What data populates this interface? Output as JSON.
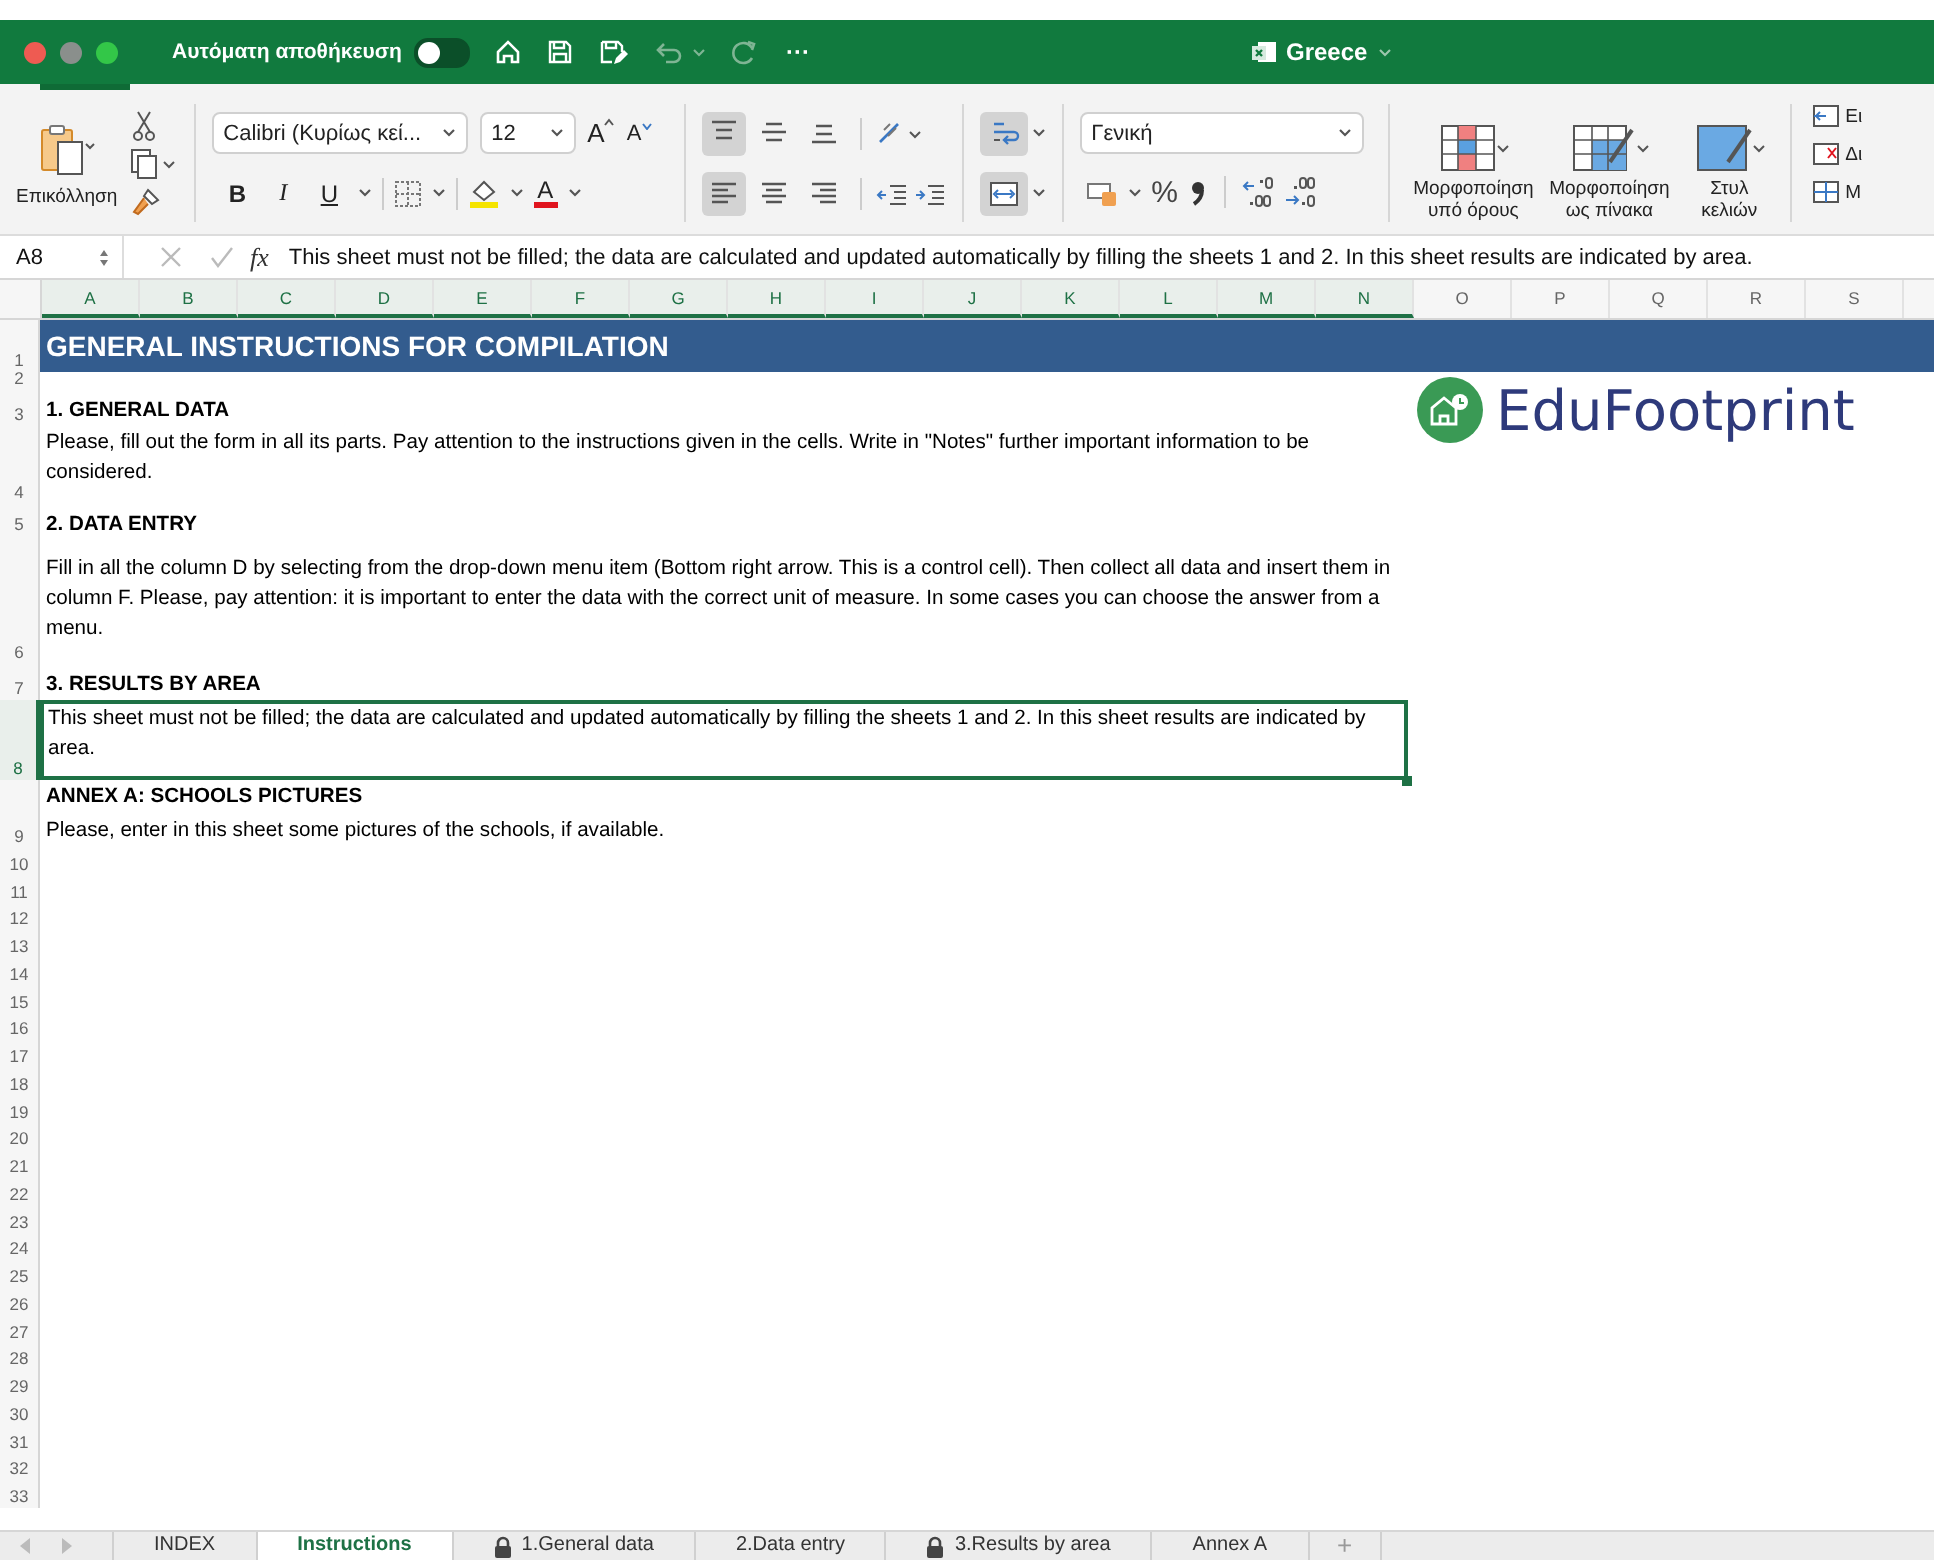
{
  "title_bar": {
    "autosave_label": "Αυτόματη αποθήκευση",
    "autosave_on": false,
    "more": "···",
    "document_title": "Greece"
  },
  "ribbon": {
    "paste_label": "Επικόλληση",
    "font_name": "Calibri (Κυρίως κεί...",
    "font_size": "12",
    "grow_label": "A",
    "shrink_label": "A",
    "format_buttons": [
      {
        "kind": "bold",
        "label": "B"
      },
      {
        "kind": "italic",
        "label": "I"
      },
      {
        "kind": "underline",
        "label": "U"
      }
    ],
    "font_color_label": "A",
    "align_buttons": [
      {
        "kind": "top",
        "selected": true
      },
      {
        "kind": "middle",
        "selected": false
      },
      {
        "kind": "bottom",
        "selected": false
      },
      {
        "kind": "left",
        "selected": true
      },
      {
        "kind": "center",
        "selected": false
      },
      {
        "kind": "right",
        "selected": false
      }
    ],
    "wrap_selected": true,
    "merge_selected": true,
    "number_format": "Γενική",
    "percent": "%",
    "style_buttons": [
      {
        "kind": "conditional",
        "label": "Μορφοποίηση υπό όρους"
      },
      {
        "kind": "table",
        "label": "Μορφοποίηση ως πίνακα"
      },
      {
        "kind": "cell",
        "label": "Στυλ κελιών"
      }
    ],
    "cell_buttons": [
      {
        "kind": "insert",
        "label": "Ει"
      },
      {
        "kind": "delete",
        "label": "Δι"
      },
      {
        "kind": "format",
        "label": "Μ"
      }
    ]
  },
  "formula_bar": {
    "cell_ref": "A8",
    "fx": "fx",
    "formula": "This sheet must not be filled; the data are calculated and updated automatically by filling the sheets 1 and 2. In this sheet results are indicated by area."
  },
  "sheet": {
    "columns": [
      {
        "label": "A",
        "selected": true
      },
      {
        "label": "B",
        "selected": true
      },
      {
        "label": "C",
        "selected": true
      },
      {
        "label": "D",
        "selected": true
      },
      {
        "label": "E",
        "selected": true
      },
      {
        "label": "F",
        "selected": true
      },
      {
        "label": "G",
        "selected": true
      },
      {
        "label": "H",
        "selected": true
      },
      {
        "label": "I",
        "selected": true
      },
      {
        "label": "J",
        "selected": true
      },
      {
        "label": "K",
        "selected": true
      },
      {
        "label": "L",
        "selected": true
      },
      {
        "label": "M",
        "selected": true
      },
      {
        "label": "N",
        "selected": true
      },
      {
        "label": "O",
        "selected": false
      },
      {
        "label": "P",
        "selected": false
      },
      {
        "label": "Q",
        "selected": false
      },
      {
        "label": "R",
        "selected": false
      },
      {
        "label": "S",
        "selected": false
      }
    ],
    "rows": [
      {
        "number": "1",
        "selected": false,
        "kind": "title",
        "text": "GENERAL INSTRUCTIONS FOR COMPILATION"
      },
      {
        "number": "2",
        "selected": false,
        "kind": "empty"
      },
      {
        "number": "3",
        "selected": false,
        "kind": "heading",
        "text": "1. GENERAL DATA"
      },
      {
        "number": "4",
        "selected": false,
        "kind": "body",
        "text": "Please, fill out the form in all its parts. Pay attention to the instructions given in the cells. Write in \"Notes\" further important information to be considered."
      },
      {
        "number": "5",
        "selected": false,
        "kind": "heading",
        "text": "2. DATA ENTRY"
      },
      {
        "number": "6",
        "selected": false,
        "kind": "body",
        "text": "Fill in all the column D by selecting from the drop-down menu item (Bottom right arrow. This is a control cell). Then collect all data and insert them in column F. Please, pay attention: it is important to enter the data with the correct unit of measure. In some cases you can choose the answer from a menu."
      },
      {
        "number": "7",
        "selected": false,
        "kind": "heading",
        "text": "3. RESULTS BY AREA"
      },
      {
        "number": "8",
        "selected": true,
        "kind": "body",
        "text": "This sheet must not be filled; the data are calculated and updated automatically by filling the sheets 1 and 2. In this sheet results are indicated by area."
      },
      {
        "number": "9",
        "selected": false,
        "kind": "heading_note",
        "text": "ANNEX A: SCHOOLS PICTURES",
        "note": "Please, enter in this sheet some pictures of the schools, if available."
      },
      {
        "number": "10",
        "selected": false,
        "kind": "empty"
      },
      {
        "number": "11",
        "selected": false,
        "kind": "empty"
      },
      {
        "number": "12",
        "selected": false,
        "kind": "empty"
      },
      {
        "number": "13",
        "selected": false,
        "kind": "empty"
      },
      {
        "number": "14",
        "selected": false,
        "kind": "empty"
      },
      {
        "number": "15",
        "selected": false,
        "kind": "empty"
      },
      {
        "number": "16",
        "selected": false,
        "kind": "empty"
      },
      {
        "number": "17",
        "selected": false,
        "kind": "empty"
      },
      {
        "number": "18",
        "selected": false,
        "kind": "empty"
      },
      {
        "number": "19",
        "selected": false,
        "kind": "empty"
      },
      {
        "number": "20",
        "selected": false,
        "kind": "empty"
      },
      {
        "number": "21",
        "selected": false,
        "kind": "empty"
      },
      {
        "number": "22",
        "selected": false,
        "kind": "empty"
      },
      {
        "number": "23",
        "selected": false,
        "kind": "empty"
      },
      {
        "number": "24",
        "selected": false,
        "kind": "empty"
      },
      {
        "number": "25",
        "selected": false,
        "kind": "empty"
      },
      {
        "number": "26",
        "selected": false,
        "kind": "empty"
      },
      {
        "number": "27",
        "selected": false,
        "kind": "empty"
      },
      {
        "number": "28",
        "selected": false,
        "kind": "empty"
      },
      {
        "number": "29",
        "selected": false,
        "kind": "empty"
      },
      {
        "number": "30",
        "selected": false,
        "kind": "empty"
      },
      {
        "number": "31",
        "selected": false,
        "kind": "empty"
      },
      {
        "number": "32",
        "selected": false,
        "kind": "empty"
      },
      {
        "number": "33",
        "selected": false,
        "kind": "empty"
      }
    ],
    "logo": {
      "text": "EduFootprint"
    }
  },
  "tabs": [
    {
      "label": "INDEX",
      "locked": false,
      "selected": false
    },
    {
      "label": "Instructions",
      "locked": false,
      "selected": true
    },
    {
      "label": "1.General data",
      "locked": true,
      "selected": false
    },
    {
      "label": "2.Data entry",
      "locked": false,
      "selected": false
    },
    {
      "label": "3.Results by area",
      "locked": true,
      "selected": false
    },
    {
      "label": "Annex A",
      "locked": false,
      "selected": false
    }
  ],
  "add_tab": "+"
}
